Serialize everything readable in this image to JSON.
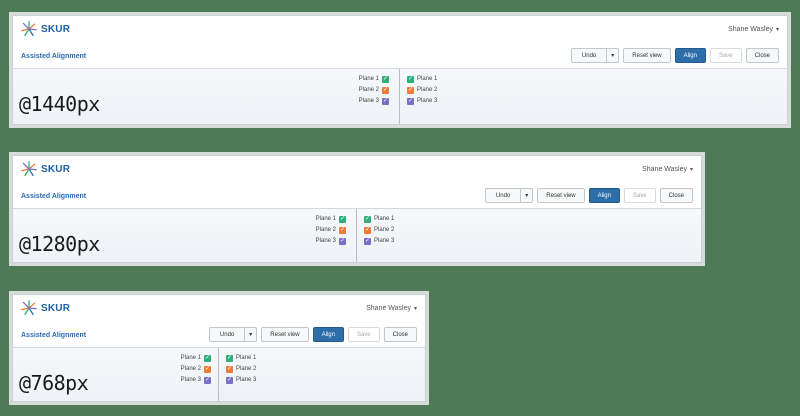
{
  "app": {
    "brand": "SKUR",
    "user": "Shane Wasley",
    "page_title": "Assisted Alignment"
  },
  "toolbar": {
    "undo": "Undo",
    "reset": "Reset view",
    "align": "Align",
    "save": "Save",
    "close": "Close"
  },
  "planes": [
    {
      "label": "Plane 1",
      "color": "#2eb07a",
      "checked": true
    },
    {
      "label": "Plane 2",
      "color": "#f07a3a",
      "checked": true
    },
    {
      "label": "Plane 3",
      "color": "#7a6fc4",
      "checked": true
    }
  ],
  "viewports": [
    {
      "label": "@1440px"
    },
    {
      "label": "@1280px"
    },
    {
      "label": "@768px"
    }
  ]
}
